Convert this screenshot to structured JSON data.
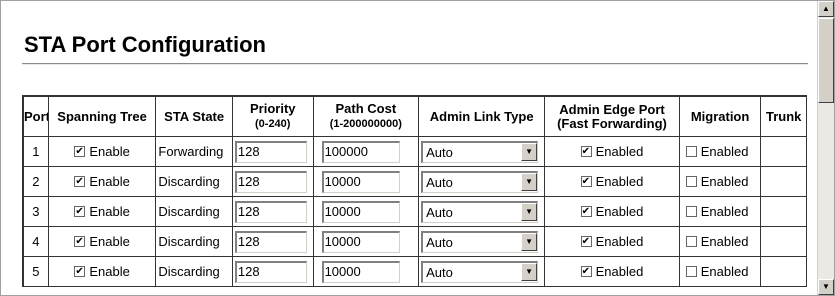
{
  "page": {
    "title": "STA Port Configuration"
  },
  "table": {
    "headers": {
      "port": "Port",
      "spanning_tree": "Spanning Tree",
      "sta_state": "STA State",
      "priority": "Priority",
      "priority_sub": "(0-240)",
      "path_cost": "Path Cost",
      "path_cost_sub": "(1-200000000)",
      "admin_link_type": "Admin Link Type",
      "admin_edge_port": "Admin Edge Port",
      "admin_edge_port_sub": "(Fast Forwarding)",
      "migration": "Migration",
      "trunk": "Trunk"
    },
    "rows": [
      {
        "port": "1",
        "spanning_tree_label": "Enable",
        "spanning_tree_checked": true,
        "sta_state": "Forwarding",
        "priority": "128",
        "path_cost": "100000",
        "admin_link_type": "Auto",
        "admin_edge_label": "Enabled",
        "admin_edge_checked": true,
        "migration_label": "Enabled",
        "migration_checked": false,
        "trunk": ""
      },
      {
        "port": "2",
        "spanning_tree_label": "Enable",
        "spanning_tree_checked": true,
        "sta_state": "Discarding",
        "priority": "128",
        "path_cost": "10000",
        "admin_link_type": "Auto",
        "admin_edge_label": "Enabled",
        "admin_edge_checked": true,
        "migration_label": "Enabled",
        "migration_checked": false,
        "trunk": ""
      },
      {
        "port": "3",
        "spanning_tree_label": "Enable",
        "spanning_tree_checked": true,
        "sta_state": "Discarding",
        "priority": "128",
        "path_cost": "10000",
        "admin_link_type": "Auto",
        "admin_edge_label": "Enabled",
        "admin_edge_checked": true,
        "migration_label": "Enabled",
        "migration_checked": false,
        "trunk": ""
      },
      {
        "port": "4",
        "spanning_tree_label": "Enable",
        "spanning_tree_checked": true,
        "sta_state": "Discarding",
        "priority": "128",
        "path_cost": "10000",
        "admin_link_type": "Auto",
        "admin_edge_label": "Enabled",
        "admin_edge_checked": true,
        "migration_label": "Enabled",
        "migration_checked": false,
        "trunk": ""
      },
      {
        "port": "5",
        "spanning_tree_label": "Enable",
        "spanning_tree_checked": true,
        "sta_state": "Discarding",
        "priority": "128",
        "path_cost": "10000",
        "admin_link_type": "Auto",
        "admin_edge_label": "Enabled",
        "admin_edge_checked": true,
        "migration_label": "Enabled",
        "migration_checked": false,
        "trunk": ""
      }
    ]
  },
  "icons": {
    "dropdown_arrow": "chevron-down-icon",
    "scroll_up": "arrow-up-icon",
    "scroll_down": "arrow-down-icon",
    "checkbox": "checkbox-icon"
  },
  "colors": {
    "text": "#000000",
    "control_face": "#d4d0c8",
    "background": "#ffffff"
  }
}
